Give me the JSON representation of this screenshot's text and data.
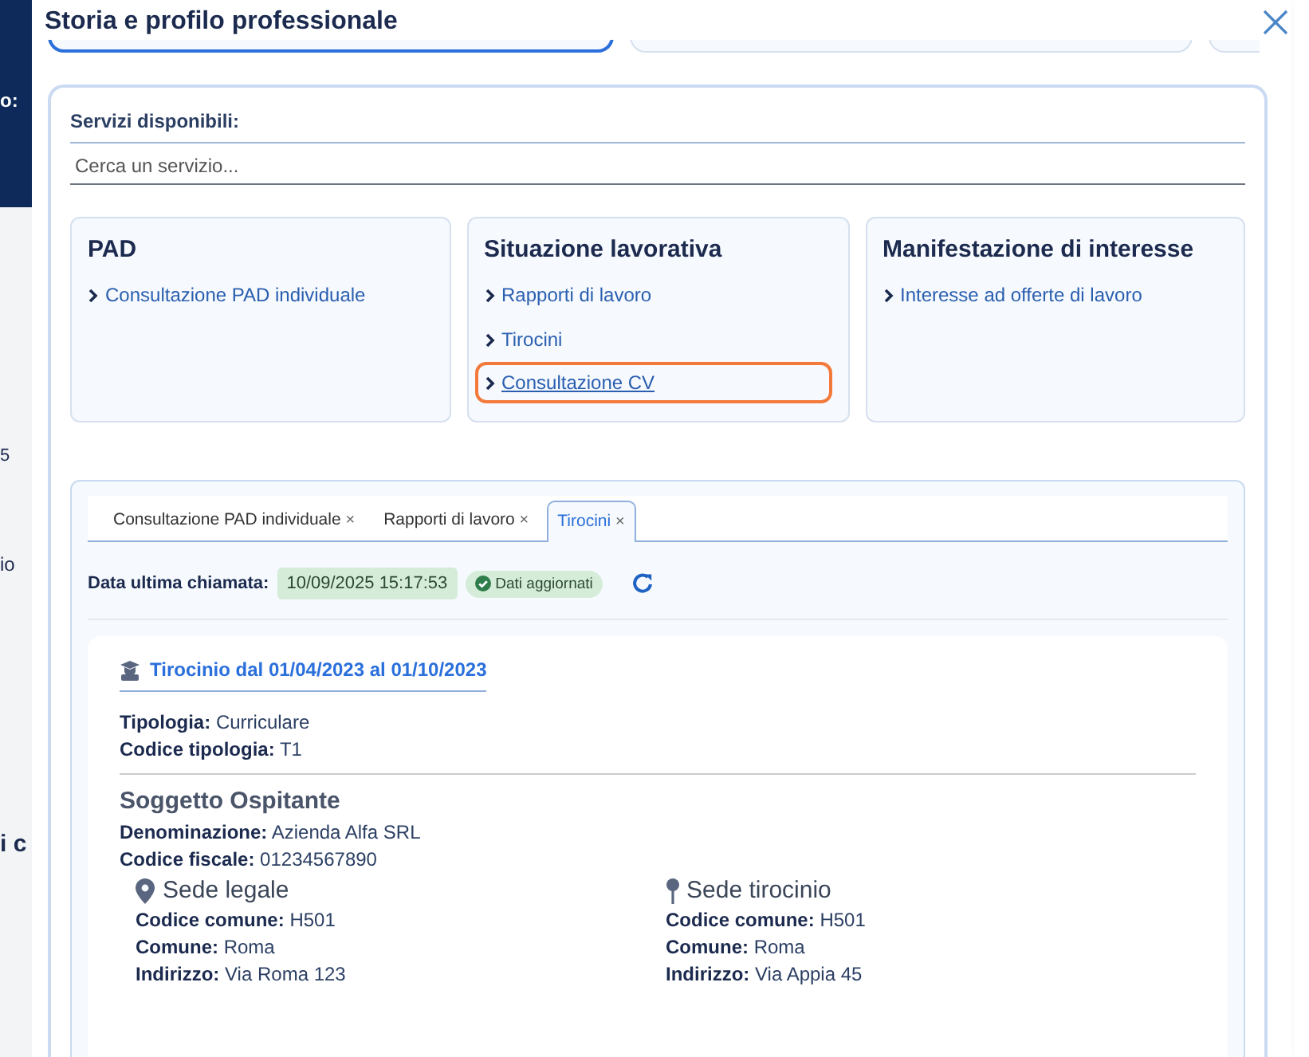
{
  "background_page": {
    "fragments": [
      "o:",
      "5",
      "io",
      "i c"
    ]
  },
  "modal": {
    "title": "Storia e profilo professionale"
  },
  "top_tabs": [
    {
      "selected": true
    },
    {
      "selected": false
    },
    {
      "selected": false
    }
  ],
  "services": {
    "label": "Servizi disponibili:",
    "search": {
      "placeholder": "Cerca un servizio..."
    },
    "groups": [
      {
        "title": "PAD",
        "links": [
          {
            "label": "Consultazione PAD individuale",
            "highlighted": false
          }
        ]
      },
      {
        "title": "Situazione lavorativa",
        "links": [
          {
            "label": "Rapporti di lavoro",
            "highlighted": false
          },
          {
            "label": "Tirocini",
            "highlighted": false
          },
          {
            "label": "Consultazione CV",
            "highlighted": true
          }
        ]
      },
      {
        "title": "Manifestazione di interesse",
        "links": [
          {
            "label": "Interesse ad offerte di lavoro",
            "highlighted": false
          }
        ]
      }
    ]
  },
  "open_tabs": [
    {
      "label": "Consultazione PAD individuale",
      "close": "×",
      "selected": false
    },
    {
      "label": "Rapporti di lavoro",
      "close": "×",
      "selected": false
    },
    {
      "label": "Tirocini",
      "close": "×",
      "selected": true
    }
  ],
  "last_call": {
    "label": "Data ultima chiamata:",
    "value": "10/09/2025 15:17:53",
    "status": "Dati aggiornati"
  },
  "record": {
    "title": "Tirocinio dal 01/04/2023 al 01/10/2023",
    "fields": [
      {
        "label": "Tipologia:",
        "value": "Curriculare"
      },
      {
        "label": "Codice tipologia:",
        "value": "T1"
      }
    ],
    "host": {
      "title": "Soggetto Ospitante",
      "fields": [
        {
          "label": "Denominazione:",
          "value": "Azienda Alfa SRL"
        },
        {
          "label": "Codice fiscale:",
          "value": "01234567890"
        }
      ],
      "sites": [
        {
          "kind": "legal",
          "title": "Sede legale",
          "fields": [
            {
              "label": "Codice comune:",
              "value": "H501"
            },
            {
              "label": "Comune:",
              "value": "Roma"
            },
            {
              "label": "Indirizzo:",
              "value": "Via Roma 123"
            }
          ]
        },
        {
          "kind": "training",
          "title": "Sede tirocinio",
          "fields": [
            {
              "label": "Codice comune:",
              "value": "H501"
            },
            {
              "label": "Comune:",
              "value": "Roma"
            },
            {
              "label": "Indirizzo:",
              "value": "Via Appia 45"
            }
          ]
        }
      ]
    }
  }
}
